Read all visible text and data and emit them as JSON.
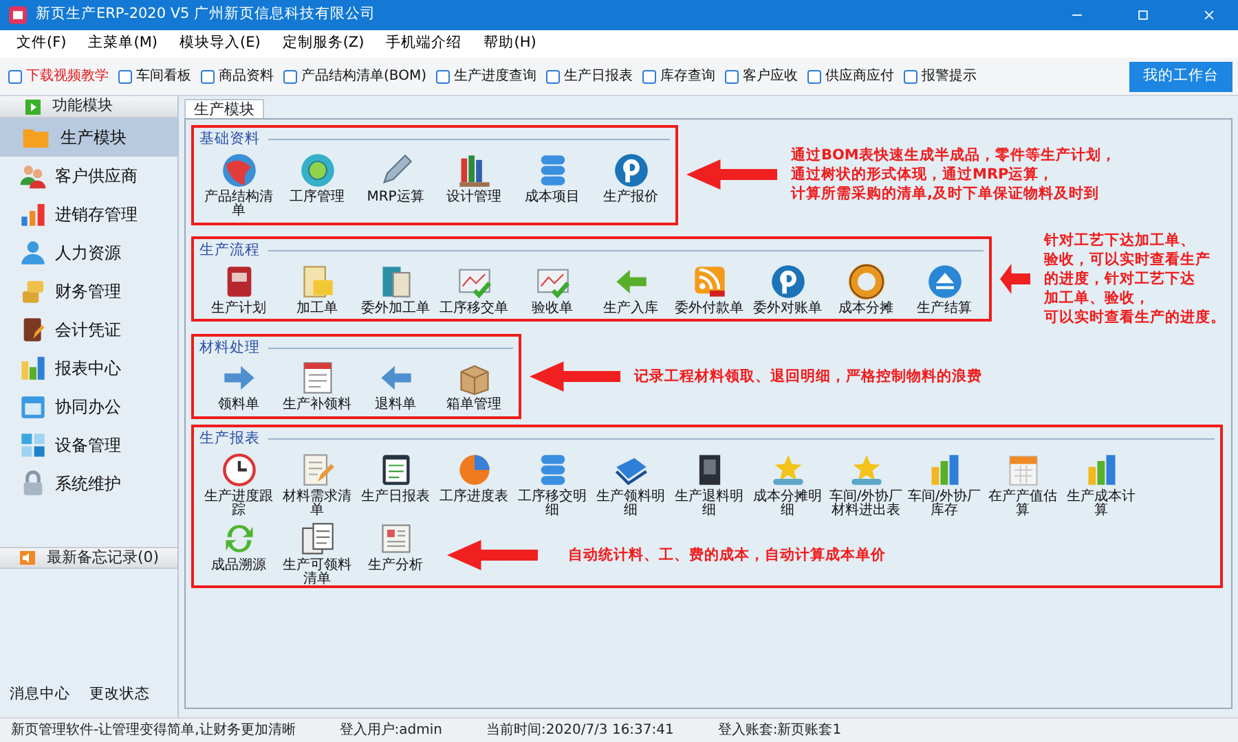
{
  "window": {
    "title": "新页生产ERP-2020 V5 广州新页信息科技有限公司"
  },
  "menu": [
    "文件(F)",
    "主菜单(M)",
    "模块导入(E)",
    "定制服务(Z)",
    "手机端介绍",
    "帮助(H)"
  ],
  "toolbar": {
    "items": [
      {
        "label": "下载视频教学",
        "emphasized": true
      },
      {
        "label": "车间看板",
        "emphasized": false
      },
      {
        "label": "商品资料",
        "emphasized": false
      },
      {
        "label": "产品结构清单(BOM)",
        "emphasized": false
      },
      {
        "label": "生产进度查询",
        "emphasized": false
      },
      {
        "label": "生产日报表",
        "emphasized": false
      },
      {
        "label": "库存查询",
        "emphasized": false
      },
      {
        "label": "客户应收",
        "emphasized": false
      },
      {
        "label": "供应商应付",
        "emphasized": false
      },
      {
        "label": "报警提示",
        "emphasized": false
      }
    ],
    "workbench_button": "我的工作台"
  },
  "sidebar": {
    "header": "功能模块",
    "items": [
      {
        "label": "生产模块",
        "selected": true
      },
      {
        "label": "客户供应商",
        "selected": false
      },
      {
        "label": "进销存管理",
        "selected": false
      },
      {
        "label": "人力资源",
        "selected": false
      },
      {
        "label": "财务管理",
        "selected": false
      },
      {
        "label": "会计凭证",
        "selected": false
      },
      {
        "label": "报表中心",
        "selected": false
      },
      {
        "label": "协同办公",
        "selected": false
      },
      {
        "label": "设备管理",
        "selected": false
      },
      {
        "label": "系统维护",
        "selected": false
      }
    ],
    "memo": "最新备忘记录(0)",
    "footer_links": [
      "消息中心",
      "更改状态"
    ]
  },
  "tabs": [
    {
      "label": "生产模块",
      "selected": true
    }
  ],
  "sections": [
    {
      "title": "基础资料",
      "kind": "side",
      "items": [
        "产品结构清单",
        "工序管理",
        "MRP运算",
        "设计管理",
        "成本项目",
        "生产报价"
      ],
      "note": [
        "通过BOM表快速生成半成品，零件等生产计划，",
        "通过树状的形式体现，通过MRP运算，",
        "计算所需采购的清单,及时下单保证物料及时到"
      ]
    },
    {
      "title": "生产流程",
      "kind": "side",
      "items": [
        "生产计划",
        "加工单",
        "委外加工单",
        "工序移交单",
        "验收单",
        "生产入库",
        "委外付款单",
        "委外对账单",
        "成本分摊",
        "生产结算"
      ],
      "note": [
        "针对工艺下达加工单、",
        "验收，可以实时查看生产",
        "的进度，针对工艺下达",
        "加工单、验收，",
        "可以实时查看生产的进度。"
      ]
    },
    {
      "title": "材料处理",
      "kind": "side",
      "items": [
        "领料单",
        "生产补领料",
        "退料单",
        "箱单管理"
      ],
      "note": [
        "记录工程材料领取、退回明细，严格控制物料的浪费"
      ]
    },
    {
      "title": "生产报表",
      "kind": "inside",
      "items": [
        "生产进度跟踪",
        "材料需求清单",
        "生产日报表",
        "工序进度表",
        "工序移交明细",
        "生产领料明细",
        "生产退料明细",
        "成本分摊明细",
        "车间/外协厂材料进出表",
        "车间/外协厂库存",
        "在产产值估算",
        "生产成本计算",
        "成品溯源",
        "生产可领料清单",
        "生产分析"
      ],
      "note": [
        "自动统计料、工、费的成本，自动计算成本单价"
      ]
    }
  ],
  "status_bar": [
    "新页管理软件-让管理变得简单,让财务更加清晰",
    "登入用户:admin",
    "当前时间:2020/7/3 16:37:41",
    "登入账套:新页账套1"
  ]
}
